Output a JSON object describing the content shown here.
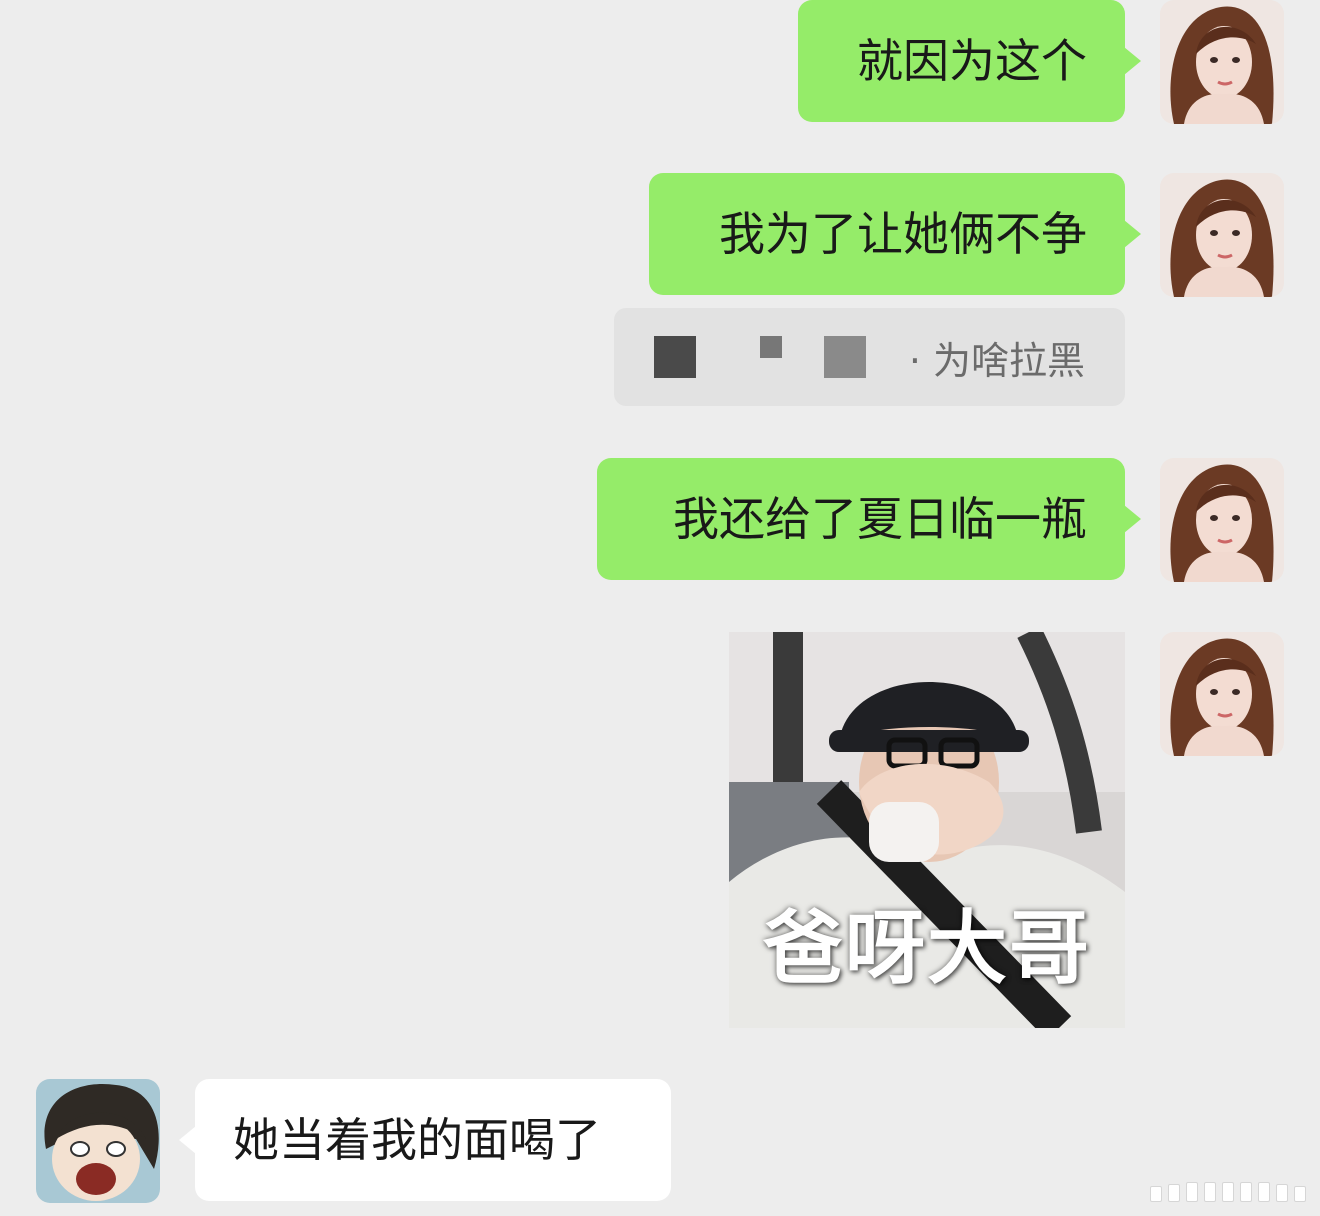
{
  "messages": [
    {
      "side": "me",
      "text": "就因为这个"
    },
    {
      "side": "me",
      "text": "我为了让她俩不争"
    },
    {
      "side": "me",
      "text": "我还给了夏日临一瓶"
    },
    {
      "side": "me",
      "sticker_caption": "爸呀大哥"
    },
    {
      "side": "other",
      "text": "她当着我的面喝了"
    }
  ],
  "quote": {
    "text": "为啥拉黑"
  },
  "colors": {
    "self_bubble": "#95ec69",
    "other_bubble": "#ffffff",
    "background": "#ededed"
  }
}
